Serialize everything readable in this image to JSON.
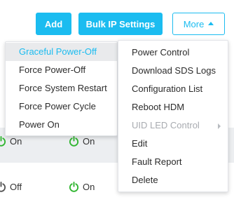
{
  "toolbar": {
    "add_label": "Add",
    "bulk_label": "Bulk IP Settings",
    "more_label": "More"
  },
  "table": {
    "row_a": {
      "status_left": "On",
      "status_right": "On"
    },
    "row_b": {
      "status_left": "Off",
      "status_right": "On"
    }
  },
  "power_menu": {
    "items": [
      {
        "label": "Graceful Power-Off",
        "state": "hovered"
      },
      {
        "label": "Force Power-Off"
      },
      {
        "label": "Force System Restart"
      },
      {
        "label": "Force Power Cycle"
      },
      {
        "label": "Power On"
      }
    ]
  },
  "more_menu": {
    "items": [
      {
        "label": "Power Control"
      },
      {
        "label": "Download SDS Logs"
      },
      {
        "label": "Configuration List"
      },
      {
        "label": "Reboot HDM"
      },
      {
        "label": "UID LED Control",
        "state": "disabled",
        "has_submenu": true
      },
      {
        "label": "Edit"
      },
      {
        "label": "Fault Report"
      },
      {
        "label": "Delete"
      }
    ]
  },
  "colors": {
    "accent": "#1bbcf0",
    "power_on": "#2fb52f",
    "power_off": "#555555",
    "hover_bg": "#e9eaec",
    "row_bg": "#eceef1"
  }
}
